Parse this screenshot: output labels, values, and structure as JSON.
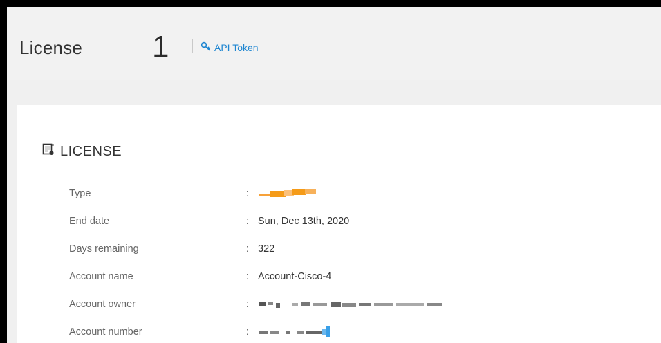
{
  "header": {
    "title": "License",
    "count": "1",
    "api_token_label": "API Token"
  },
  "section": {
    "title": "LICENSE"
  },
  "rows": [
    {
      "label": "Type",
      "value": ""
    },
    {
      "label": "End date",
      "value": "Sun, Dec 13th, 2020"
    },
    {
      "label": "Days remaining",
      "value": "322"
    },
    {
      "label": "Account name",
      "value": "Account-Cisco-4"
    },
    {
      "label": "Account owner",
      "value": ""
    },
    {
      "label": "Account number",
      "value": ""
    }
  ],
  "colors": {
    "accent": "#1f86d1",
    "redacted_orange": "#f59b18",
    "redacted_blue": "#3aa0e8"
  }
}
